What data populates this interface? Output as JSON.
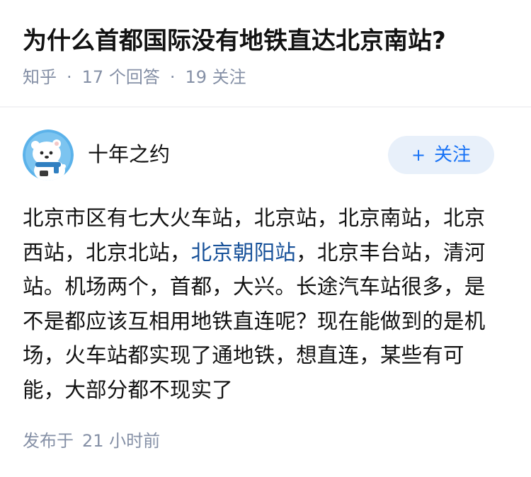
{
  "question": {
    "title": "为什么首都国际没有地铁直达北京南站?",
    "meta": {
      "source": "知乎",
      "separator": "·",
      "answers_count": "17",
      "answers_label": "个回答",
      "followers_count": "19",
      "followers_label": "关注"
    }
  },
  "answer": {
    "author": {
      "name": "十年之约",
      "avatar_icon": "bear-mascot-avatar-icon"
    },
    "follow_button": {
      "icon": "+",
      "label": "关注"
    },
    "content": {
      "part1": "北京市区有七大火车站，北京站，北京南站，北京西站，北京北站，",
      "link_text": "北京朝阳站",
      "part2": "，北京丰台站，清河站。机场两个，首都，大兴。长途汽车站很多，是不是都应该互相用地铁直连呢？现在能做到的是机场，火车站都实现了通地铁，想直连，某些有可能，大部分都不现实了"
    },
    "published": {
      "label": "发布于",
      "time": "21 小时前"
    }
  },
  "colors": {
    "title": "#121212",
    "meta": "#8590a6",
    "link": "#175199",
    "accent": "#1772f6",
    "button_bg": "#e8f0fa",
    "avatar_bg": "#5bb2ea"
  }
}
